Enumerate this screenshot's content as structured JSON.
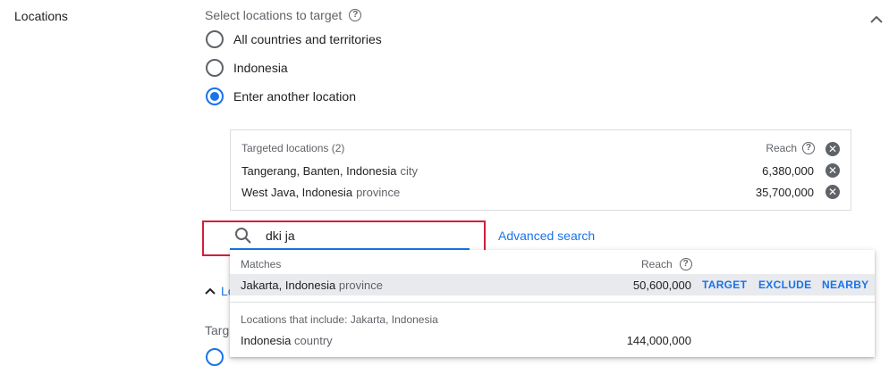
{
  "section": {
    "label": "Locations"
  },
  "question": {
    "title": "Select locations to target",
    "help": "?"
  },
  "options": [
    {
      "label": "All countries and territories",
      "checked": false
    },
    {
      "label": "Indonesia",
      "checked": false
    },
    {
      "label": "Enter another location",
      "checked": true
    }
  ],
  "targeted": {
    "header": "Targeted locations (2)",
    "reach_label": "Reach",
    "items": [
      {
        "name": "Tangerang, Banten, Indonesia",
        "type": "city",
        "reach": "6,380,000"
      },
      {
        "name": "West Java, Indonesia",
        "type": "province",
        "reach": "35,700,000"
      }
    ]
  },
  "search": {
    "value": "dki ja",
    "advanced_label": "Advanced search"
  },
  "dropdown": {
    "matches_header": "Matches",
    "reach_label": "Reach",
    "match": {
      "name": "Jakarta, Indonesia",
      "type": "province",
      "reach": "50,600,000"
    },
    "actions": {
      "target": "TARGET",
      "exclude": "EXCLUDE",
      "nearby": "NEARBY"
    },
    "includes_header": "Locations that include: Jakarta, Indonesia",
    "include": {
      "name": "Indonesia",
      "type": "country",
      "reach": "144,000,000"
    }
  },
  "behind": {
    "link_text": "Lo",
    "targ_text": "Targ"
  },
  "colors": {
    "accent": "#1a73e8",
    "highlight": "#d11f3d"
  }
}
